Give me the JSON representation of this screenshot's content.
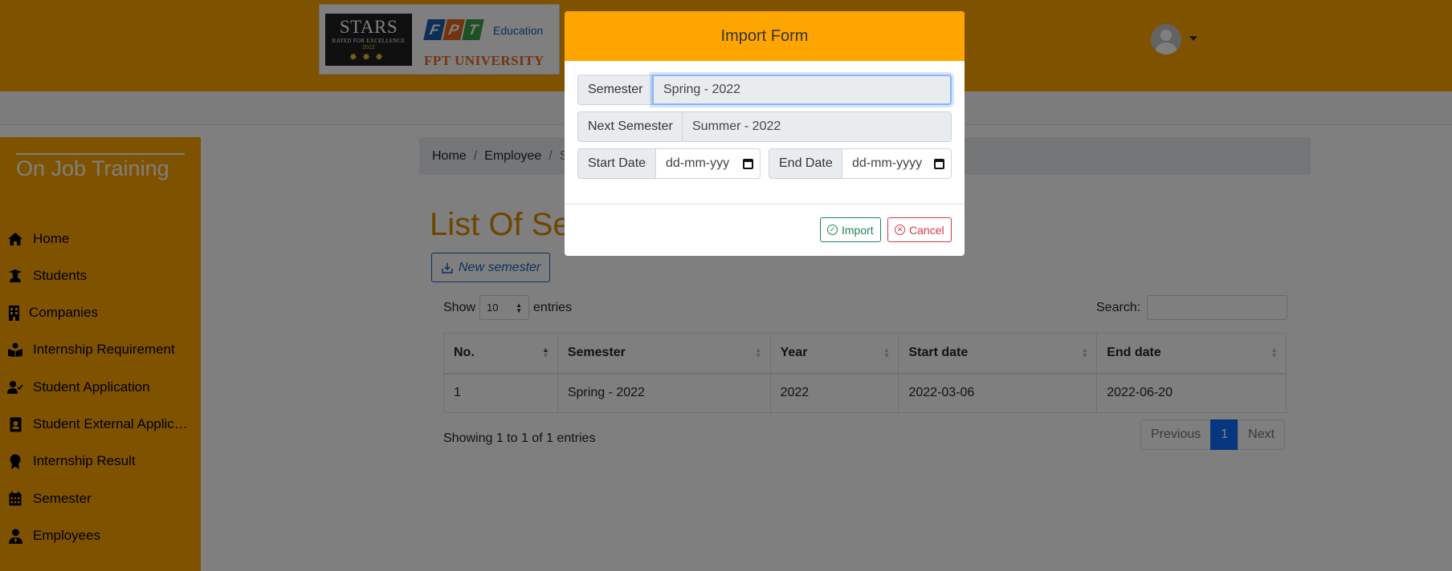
{
  "header": {
    "stars": {
      "title": "STARS",
      "subtitle": "RATED FOR EXCELLENCE",
      "year": "2012"
    },
    "fpt": {
      "letters": [
        "F",
        "P",
        "T"
      ],
      "education": "Education",
      "university": "FPT UNIVERSITY"
    },
    "colors": {
      "brand_orange": "#FFA500",
      "fpt_orange": "#e8661f",
      "fpt_blue": "#1b5fae",
      "fpt_green": "#3aa34a"
    }
  },
  "sidebar": {
    "title": "On Job Training",
    "items": [
      {
        "label": "Home",
        "icon": "home-icon"
      },
      {
        "label": "Students",
        "icon": "student-icon"
      },
      {
        "label": "Companies",
        "icon": "building-icon"
      },
      {
        "label": "Internship Requirement",
        "icon": "book-reader-icon"
      },
      {
        "label": "Student Application",
        "icon": "user-check-icon"
      },
      {
        "label": "Student External Application",
        "icon": "id-badge-icon"
      },
      {
        "label": "Internship Result",
        "icon": "award-icon"
      },
      {
        "label": "Semester",
        "icon": "calendar-icon"
      },
      {
        "label": "Employees",
        "icon": "user-tie-icon"
      }
    ]
  },
  "breadcrumb": {
    "items": [
      "Home",
      "Employee",
      "S"
    ]
  },
  "main": {
    "title": "List Of Semester",
    "new_button": "New semester",
    "show_label": "Show",
    "entries_label": "entries",
    "page_length": "10",
    "search_label": "Search:",
    "search_value": ""
  },
  "table": {
    "headers": [
      "No.",
      "Semester",
      "Year",
      "Start date",
      "End date"
    ],
    "rows": [
      [
        "1",
        "Spring - 2022",
        "2022",
        "2022-03-06",
        "2022-06-20"
      ]
    ]
  },
  "footer": {
    "info": "Showing 1 to 1 of 1 entries",
    "prev": "Previous",
    "page": "1",
    "next": "Next"
  },
  "modal": {
    "title": "Import Form",
    "semester_label": "Semester",
    "semester_value": "Spring - 2022",
    "next_semester_label": "Next Semester",
    "next_semester_value": "Summer - 2022",
    "start_date_label": "Start Date",
    "start_date_placeholder": "dd-mm-yyy",
    "end_date_label": "End Date",
    "end_date_placeholder": "dd-mm-yyyy",
    "import_button": "Import",
    "cancel_button": "Cancel"
  }
}
